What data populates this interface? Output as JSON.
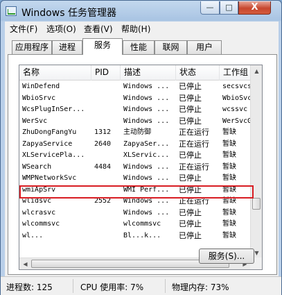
{
  "window": {
    "title": "Windows 任务管理器",
    "controls": {
      "minimize": "—",
      "maximize": "□",
      "close": "X"
    }
  },
  "menu": [
    "文件(F)",
    "选项(O)",
    "查看(V)",
    "帮助(H)"
  ],
  "tabs": [
    {
      "label": "应用程序",
      "active": false
    },
    {
      "label": "进程",
      "active": false
    },
    {
      "label": "服务",
      "active": true
    },
    {
      "label": "性能",
      "active": false
    },
    {
      "label": "联网",
      "active": false
    },
    {
      "label": "用户",
      "active": false
    }
  ],
  "table": {
    "columns": [
      "名称",
      "PID",
      "描述",
      "状态",
      "工作组"
    ],
    "rows": [
      {
        "name": "WinDefend",
        "pid": "",
        "desc": "Windows ...",
        "status": "已停止",
        "group": "secsvcs"
      },
      {
        "name": "WbioSrvc",
        "pid": "",
        "desc": "Windows ...",
        "status": "已停止",
        "group": "WbioSvcG"
      },
      {
        "name": "WcsPlugInSer...",
        "pid": "",
        "desc": "Windows ...",
        "status": "已停止",
        "group": "wcssvc"
      },
      {
        "name": "WerSvc",
        "pid": "",
        "desc": "Windows ...",
        "status": "已停止",
        "group": "WerSvcG"
      },
      {
        "name": "ZhuDongFangYu",
        "pid": "1312",
        "desc": "主动防御",
        "status": "正在运行",
        "group": "暂缺"
      },
      {
        "name": "ZapyaService",
        "pid": "2640",
        "desc": "ZapyaSer...",
        "status": "正在运行",
        "group": "暂缺",
        "highlighted": true
      },
      {
        "name": "XLServicePla...",
        "pid": "",
        "desc": "XLServic...",
        "status": "已停止",
        "group": "暂缺"
      },
      {
        "name": "WSearch",
        "pid": "4484",
        "desc": "Windows ...",
        "status": "正在运行",
        "group": "暂缺"
      },
      {
        "name": "WMPNetworkSvc",
        "pid": "",
        "desc": "Windows ...",
        "status": "已停止",
        "group": "暂缺"
      },
      {
        "name": "wmiApSrv",
        "pid": "",
        "desc": "WMI Perf...",
        "status": "已停止",
        "group": "暂缺"
      },
      {
        "name": "wlidsvc",
        "pid": "2552",
        "desc": "Windows ...",
        "status": "正在运行",
        "group": "暂缺"
      },
      {
        "name": "wlcrasvc",
        "pid": "",
        "desc": "Windows ...",
        "status": "已停止",
        "group": "暂缺"
      },
      {
        "name": "wlcommsvc",
        "pid": "",
        "desc": "wlcommsvc",
        "status": "已停止",
        "group": "暂缺"
      },
      {
        "name": "wl...",
        "pid": "",
        "desc": "Bl...k...",
        "status": "已停止",
        "group": "暂缺"
      }
    ]
  },
  "buttons": {
    "services": "服务(S)..."
  },
  "status": {
    "processes": "进程数: 125",
    "cpu": "CPU 使用率: 7%",
    "memory": "物理内存: 73%"
  },
  "colors": {
    "highlight_border": "#d81d23",
    "title_gradient": "#a9c4e3"
  }
}
